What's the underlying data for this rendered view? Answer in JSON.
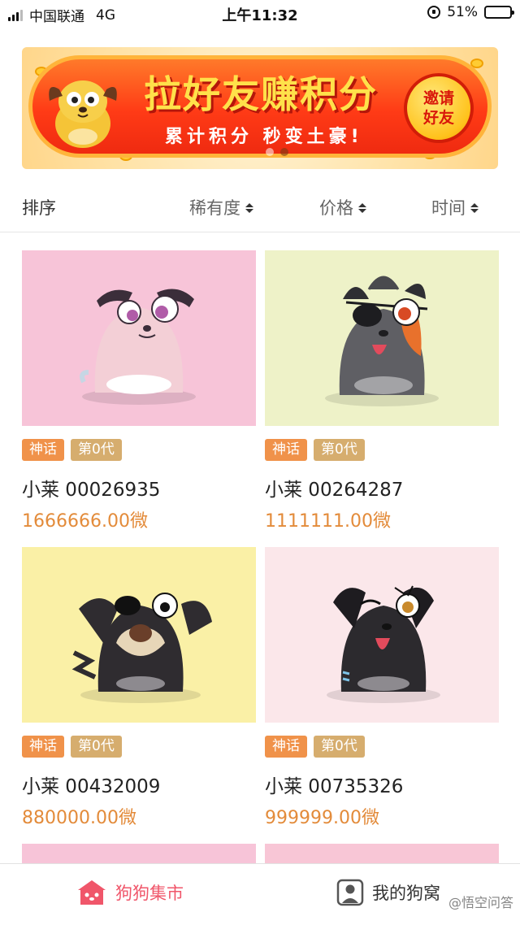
{
  "status_bar": {
    "carrier": "中国联通",
    "network": "4G",
    "time": "上午11:32",
    "battery": "51%",
    "battery_level": 0.51
  },
  "banner": {
    "title": "拉好友赚积分",
    "subtitle": "累计积分 秒变土豪!",
    "button_label": "邀请好友",
    "slide_count": 2,
    "active_slide": 2
  },
  "sort_bar": {
    "label": "排序",
    "options": [
      {
        "label": "稀有度",
        "icon": "sort-caret-icon"
      },
      {
        "label": "价格",
        "icon": "sort-caret-icon"
      },
      {
        "label": "时间",
        "icon": "sort-caret-icon"
      }
    ]
  },
  "cards": [
    {
      "tags": [
        "神话",
        "第0代"
      ],
      "name": "小莱 00026935",
      "price": "1666666.00微",
      "bg": "#f7c4d8"
    },
    {
      "tags": [
        "神话",
        "第0代"
      ],
      "name": "小莱 00264287",
      "price": "1111111.00微",
      "bg": "#eef2c8"
    },
    {
      "tags": [
        "神话",
        "第0代"
      ],
      "name": "小莱 00432009",
      "price": "880000.00微",
      "bg": "#faf0a6"
    },
    {
      "tags": [
        "神话",
        "第0代"
      ],
      "name": "小莱 00735326",
      "price": "999999.00微",
      "bg": "#fbe7ea"
    }
  ],
  "bottom_nav": {
    "items": [
      {
        "label": "狗狗集市",
        "icon": "dog-house-icon",
        "active": true
      },
      {
        "label": "我的狗窝",
        "icon": "profile-icon",
        "active": false
      }
    ],
    "active_color": "#f0566a"
  },
  "watermark": "@悟空问答"
}
